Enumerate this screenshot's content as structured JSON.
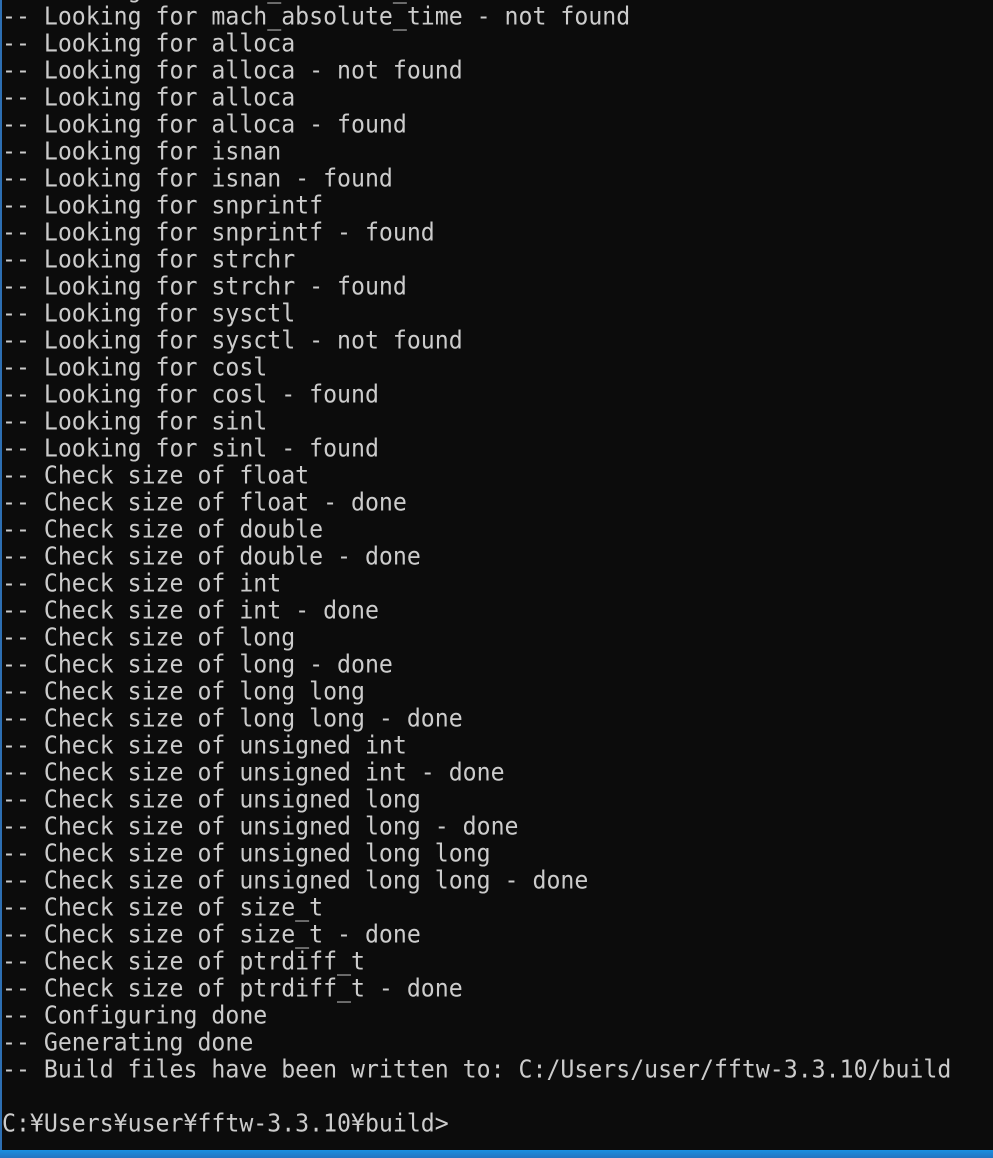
{
  "colors": {
    "background": "#0c0c0c",
    "text": "#cccccc",
    "window_border": "#1a8fe0"
  },
  "console": {
    "lines": [
      "-- Looking for mach_absolute_time",
      "-- Looking for mach_absolute_time - not found",
      "-- Looking for alloca",
      "-- Looking for alloca - not found",
      "-- Looking for alloca",
      "-- Looking for alloca - found",
      "-- Looking for isnan",
      "-- Looking for isnan - found",
      "-- Looking for snprintf",
      "-- Looking for snprintf - found",
      "-- Looking for strchr",
      "-- Looking for strchr - found",
      "-- Looking for sysctl",
      "-- Looking for sysctl - not found",
      "-- Looking for cosl",
      "-- Looking for cosl - found",
      "-- Looking for sinl",
      "-- Looking for sinl - found",
      "-- Check size of float",
      "-- Check size of float - done",
      "-- Check size of double",
      "-- Check size of double - done",
      "-- Check size of int",
      "-- Check size of int - done",
      "-- Check size of long",
      "-- Check size of long - done",
      "-- Check size of long long",
      "-- Check size of long long - done",
      "-- Check size of unsigned int",
      "-- Check size of unsigned int - done",
      "-- Check size of unsigned long",
      "-- Check size of unsigned long - done",
      "-- Check size of unsigned long long",
      "-- Check size of unsigned long long - done",
      "-- Check size of size_t",
      "-- Check size of size_t - done",
      "-- Check size of ptrdiff_t",
      "-- Check size of ptrdiff_t - done",
      "-- Configuring done",
      "-- Generating done",
      "-- Build files have been written to: C:/Users/user/fftw-3.3.10/build",
      "",
      "C:¥Users¥user¥fftw-3.3.10¥build>"
    ]
  }
}
